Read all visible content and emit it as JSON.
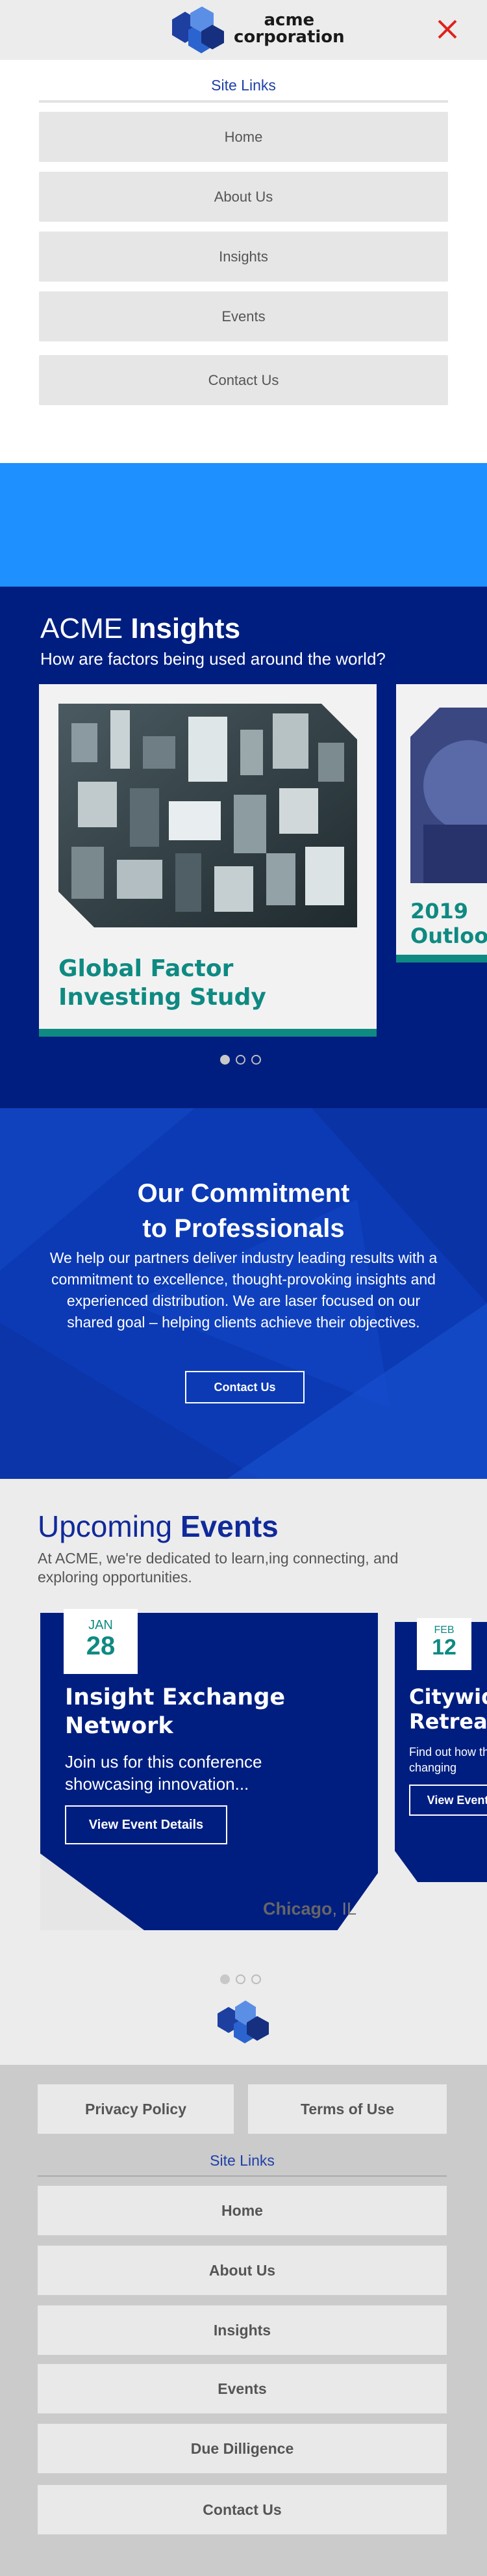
{
  "header": {
    "logo_line1": "acme",
    "logo_line2": "corporation",
    "close_icon": "close-icon"
  },
  "top_menu": {
    "title": "Site Links",
    "items": [
      "Home",
      "About Us",
      "Insights",
      "Events",
      "Contact Us"
    ]
  },
  "insights": {
    "title_light": "ACME",
    "title_bold": "Insights",
    "subtitle": "How are factors being used around the world?",
    "cards": [
      {
        "title_line1": "Global Factor",
        "title_line2": "Investing Study"
      },
      {
        "title_line1": "2019",
        "title_line2": "Outlook"
      }
    ],
    "pager": {
      "count": 3,
      "active": 1
    }
  },
  "commitment": {
    "title_line1": "Our Commitment",
    "title_line2": "to Professionals",
    "body": "We help our partners deliver industry leading results with a commitment to excellence, thought-provoking insights and experienced distribution. We are laser focused on our shared goal – helping clients achieve their objectives.",
    "button": "Contact Us"
  },
  "events": {
    "title_light": "Upcoming",
    "title_bold": "Events",
    "subtitle": "At ACME, we're dedicated to learn,ing connecting, and exploring opportunities.",
    "cards": [
      {
        "month": "JAN",
        "day": "28",
        "name_line1": "Insight Exchange",
        "name_line2": "Network",
        "desc": "Join us for this conference showcasing innovation...",
        "button": "View Event Details",
        "city": "Chicago",
        "state": ", IL"
      },
      {
        "month": "FEB",
        "day": "12",
        "name_line1": "Citywide",
        "name_line2": "Retreat",
        "desc": "Find out how the changing",
        "button": "View Event"
      }
    ],
    "pager": {
      "count": 3,
      "active": 1
    }
  },
  "footer": {
    "privacy": "Privacy Policy",
    "terms": "Terms of Use",
    "title": "Site Links",
    "items": [
      "Home",
      "About Us",
      "Insights",
      "Events",
      "Due Dilligence",
      "Contact Us"
    ]
  },
  "colors": {
    "navy": "#001e80",
    "teal": "#0e8a82",
    "bright_blue": "#1e90ff",
    "link_blue": "#1e3fa8"
  }
}
